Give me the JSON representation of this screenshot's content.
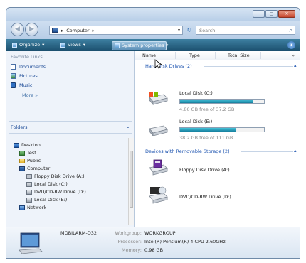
{
  "address": {
    "crumb": "Computer",
    "separator": "▸"
  },
  "search": {
    "placeholder": "Search"
  },
  "toolbar": {
    "organize": "Organize",
    "views": "Views",
    "system_properties": "System properties"
  },
  "favorites": {
    "title": "Favorite Links",
    "items": [
      {
        "label": "Documents",
        "icon": "documents-icon"
      },
      {
        "label": "Pictures",
        "icon": "pictures-icon"
      },
      {
        "label": "Music",
        "icon": "music-icon"
      }
    ],
    "more": "More »"
  },
  "folders": {
    "title": "Folders",
    "items": [
      {
        "label": "Desktop"
      },
      {
        "label": "Test"
      },
      {
        "label": "Public"
      },
      {
        "label": "Computer"
      },
      {
        "label": "Floppy Disk Drive (A:)"
      },
      {
        "label": "Local Disk (C:)"
      },
      {
        "label": "DVD/CD-RW Drive (D:)"
      },
      {
        "label": "Local Disk (E:)"
      },
      {
        "label": "Network"
      }
    ]
  },
  "columns": {
    "name": "Name",
    "type": "Type",
    "total_size": "Total Size",
    "more": "»"
  },
  "hard_disk_group": "Hard Disk Drives (2)",
  "removable_group": "Devices with Removable Storage (2)",
  "drives": {
    "c": {
      "name": "Local Disk (C:)",
      "free": "4.86 GB free of 37.2 GB",
      "used_fraction": 0.87
    },
    "e": {
      "name": "Local Disk (E:)",
      "free": "38.2 GB free of 111 GB",
      "used_fraction": 0.66
    }
  },
  "removable": {
    "floppy": {
      "name": "Floppy Disk Drive (A:)"
    },
    "dvd": {
      "name": "DVD/CD-RW Drive (D:)"
    }
  },
  "details": {
    "computer_name": "MOBILARM-D32",
    "workgroup_label": "Workgroup:",
    "workgroup": "WORKGROUP",
    "processor_label": "Processor:",
    "processor": "Intel(R) Pentium(R) 4 CPU 2.60GHz",
    "memory_label": "Memory:",
    "memory": "0.98 GB"
  },
  "colors": {
    "toolbar": "#1b4f6e",
    "link": "#1b4a96",
    "group": "#1f55b0",
    "bar_fill": "#167f9e"
  }
}
